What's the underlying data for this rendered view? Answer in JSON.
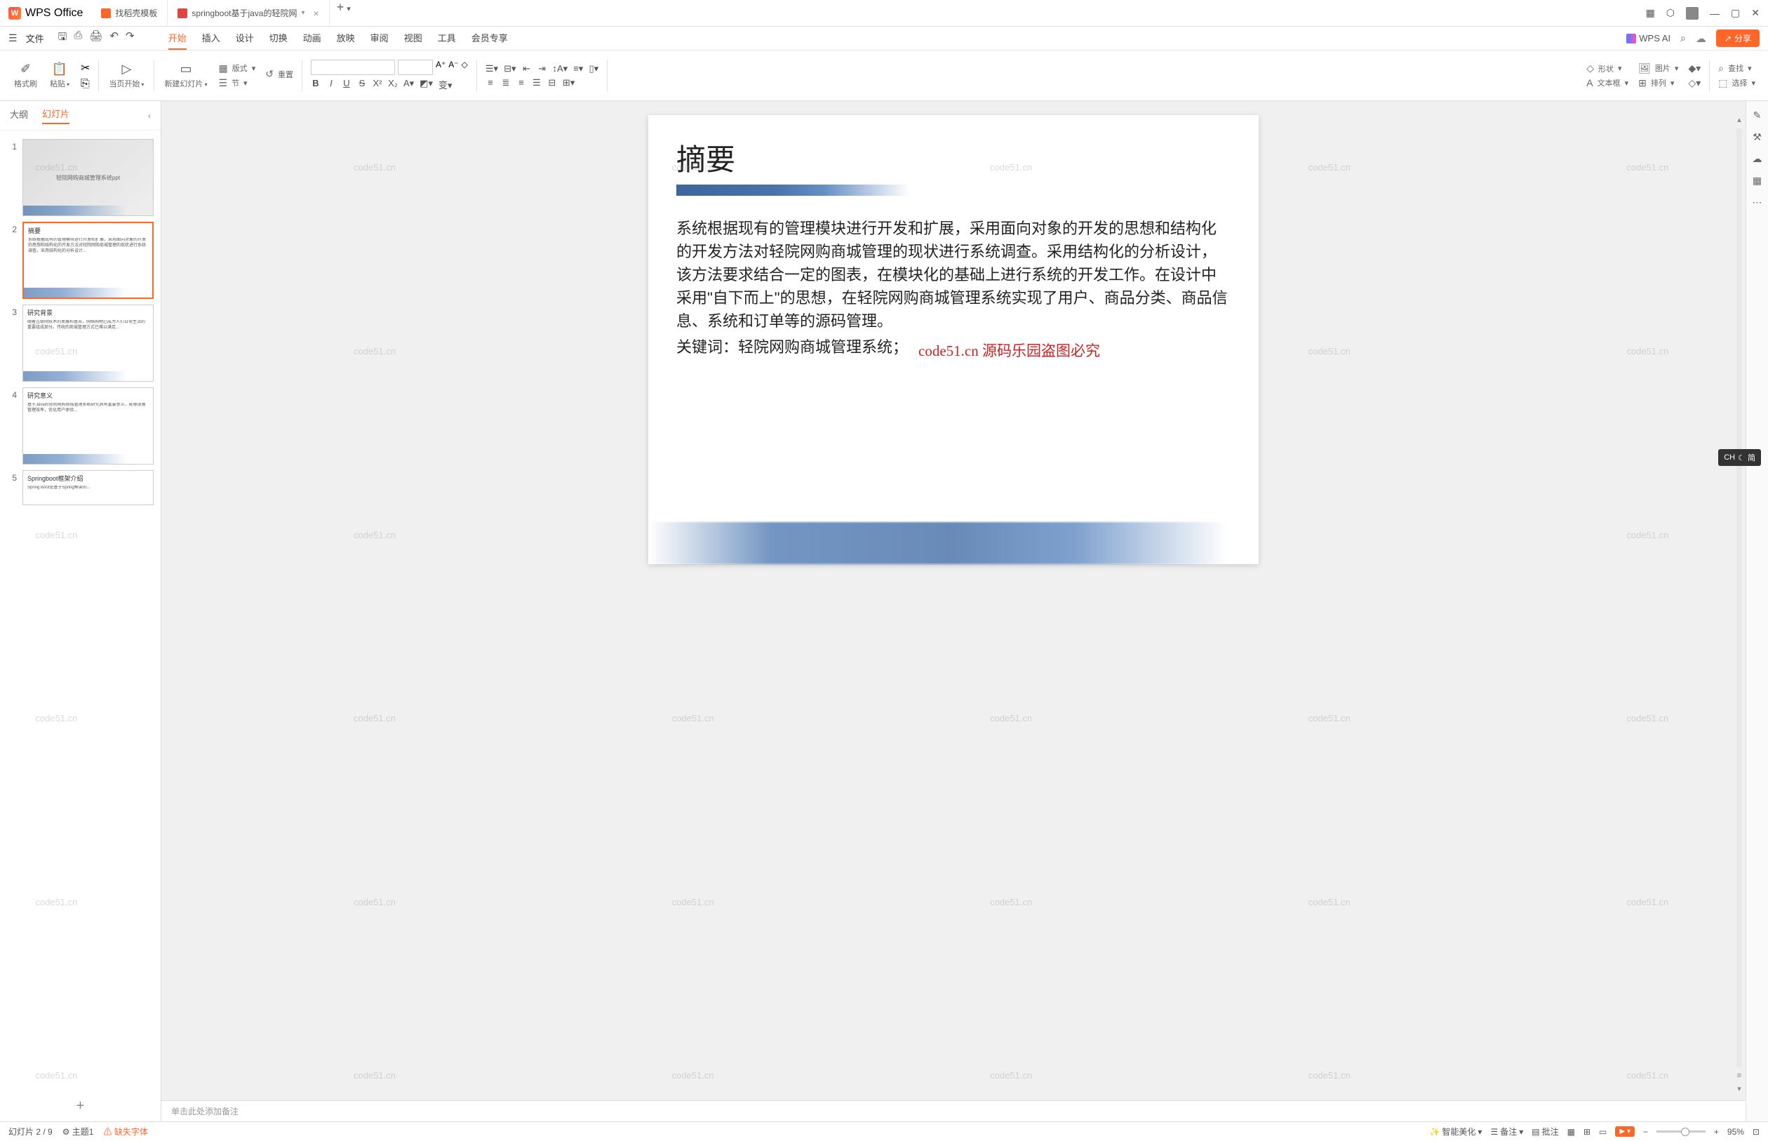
{
  "app": {
    "name": "WPS Office"
  },
  "tabs": [
    {
      "label": "找稻壳模板",
      "icon": "orange",
      "closable": false,
      "active": false
    },
    {
      "label": "springboot基于java的轻院网",
      "icon": "red",
      "closable": true,
      "active": true
    }
  ],
  "titleButtons": {
    "grid": "⊞",
    "cube": "⬚",
    "minimize": "—",
    "maximize": "▢",
    "close": "✕"
  },
  "menu": {
    "file": "文件",
    "items": [
      "开始",
      "插入",
      "设计",
      "切换",
      "动画",
      "放映",
      "审阅",
      "视图",
      "工具",
      "会员专享"
    ],
    "activeIndex": 0,
    "wpsAi": "WPS AI",
    "share": "分享"
  },
  "ribbon": {
    "format_brush": "格式刷",
    "paste": "粘贴",
    "cut_icon": "✄",
    "copy_icon": "⎘",
    "from_current": "当页开始",
    "new_slide": "新建幻灯片",
    "layout": "版式",
    "section": "节",
    "reset": "重置",
    "text_box": "文本框",
    "shape": "形状",
    "picture": "图片",
    "arrange": "排列",
    "find": "查找",
    "select": "选择"
  },
  "sidePanel": {
    "tabs": [
      "大纲",
      "幻灯片"
    ],
    "activeIndex": 1,
    "thumbnails": [
      {
        "num": 1,
        "title": "轻院网购商城管理系统ppt",
        "type": "cover"
      },
      {
        "num": 2,
        "title": "摘要",
        "type": "text",
        "active": true
      },
      {
        "num": 3,
        "title": "研究背景",
        "type": "text"
      },
      {
        "num": 4,
        "title": "研究意义",
        "type": "text"
      },
      {
        "num": 5,
        "title": "Springboot框架介绍",
        "type": "text"
      }
    ]
  },
  "slide": {
    "title": "摘要",
    "body": "系统根据现有的管理模块进行开发和扩展，采用面向对象的开发的思想和结构化的开发方法对轻院网购商城管理的现状进行系统调查。采用结构化的分析设计，该方法要求结合一定的图表，在模块化的基础上进行系统的开发工作。在设计中采用\"自下而上\"的思想，在轻院网购商城管理系统实现了用户、商品分类、商品信息、系统和订单等的源码管理。",
    "keywords": "关键词：轻院网购商城管理系统；",
    "redOverlay": "code51.cn 源码乐园盗图必究"
  },
  "notes": {
    "placeholder": "单击此处添加备注"
  },
  "statusBar": {
    "slideCounter": "幻灯片 2 / 9",
    "theme": "主题1",
    "missingFont": "缺失字体",
    "smartBeautify": "智能美化",
    "notes": "备注",
    "review": "批注",
    "zoom": "95%"
  },
  "ime": {
    "lang": "CH",
    "mode": "简"
  },
  "watermarkText": "code51.cn"
}
